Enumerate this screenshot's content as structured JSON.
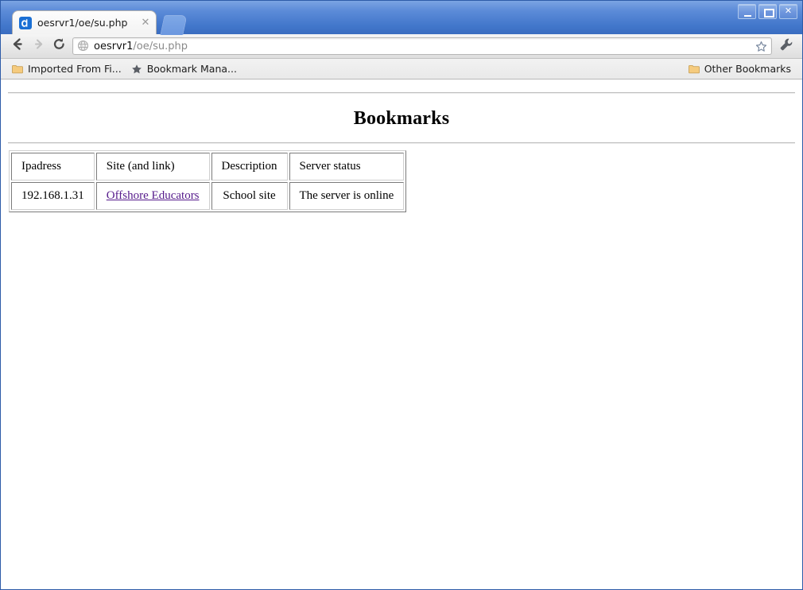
{
  "window": {
    "controls": [
      {
        "name": "minimize",
        "glyph": ""
      },
      {
        "name": "maximize",
        "glyph": ""
      },
      {
        "name": "close",
        "glyph": "✕"
      }
    ]
  },
  "tabstrip": {
    "tab": {
      "title": "oesrvr1/oe/su.php",
      "favicon": "app-favicon",
      "close_label": "✕"
    },
    "new_tab_label": ""
  },
  "toolbar": {
    "back_icon": "back-arrow-icon",
    "forward_icon": "forward-arrow-icon",
    "reload_icon": "reload-icon",
    "omnibox": {
      "page_icon": "globe-icon",
      "host": "oesrvr1",
      "path": "/oe/su.php",
      "full_url": "oesrvr1/oe/su.php",
      "star_icon": "star-icon"
    },
    "menu_icon": "wrench-icon"
  },
  "bookmarks_bar": {
    "items": [
      {
        "label": "Imported From Fi...",
        "icon": "folder-icon"
      },
      {
        "label": "Bookmark Mana...",
        "icon": "star-icon"
      }
    ],
    "other": {
      "label": "Other Bookmarks",
      "icon": "folder-icon"
    }
  },
  "page": {
    "title": "Bookmarks",
    "table": {
      "headers": [
        "Ipadress",
        "Site (and link)",
        "Description",
        "Server status"
      ],
      "rows": [
        {
          "ipadress": "192.168.1.31",
          "site": "Offshore Educators",
          "description": "School site",
          "status": "The server is online"
        }
      ]
    }
  },
  "colors": {
    "titlebar_blue": "#4a7fd0",
    "frame_blue": "#2d5ba8",
    "visited_link": "#551a8b",
    "folder_icon": "#f0c070"
  }
}
